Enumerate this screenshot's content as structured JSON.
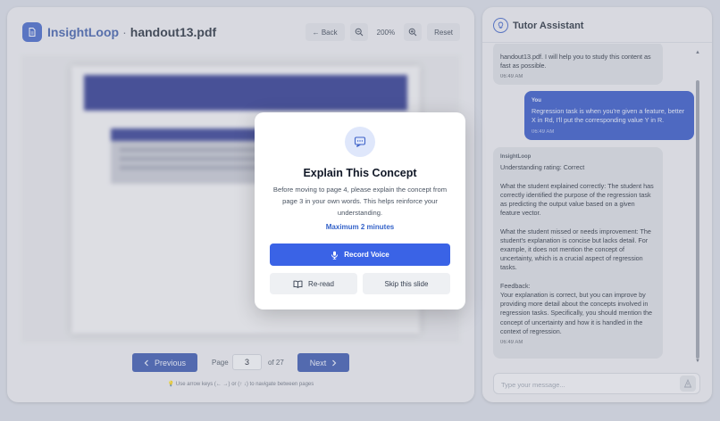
{
  "app": {
    "name": "InsightLoop",
    "separator": "·",
    "filename": "handout13.pdf"
  },
  "toolbar": {
    "back_label": "← Back",
    "zoom_level": "200%",
    "reset_label": "Reset"
  },
  "pager": {
    "previous_label": "Previous",
    "page_label": "Page",
    "current_page": "3",
    "of_label": "of 27",
    "next_label": "Next",
    "hint": "💡 Use arrow keys (← →) or (↑ ↓) to navigate between pages"
  },
  "chat": {
    "title": "Tutor Assistant",
    "messages": [
      {
        "sender": "",
        "text": "handout13.pdf. I will help you to study this content as fast as possible.",
        "time": "06:49 AM"
      },
      {
        "sender": "You",
        "text": "Regression task is when you're given a feature, better X in Rd, I'll put the corresponding value Y in R.",
        "time": "06:49 AM"
      },
      {
        "sender": "InsightLoop",
        "text": "Understanding rating: Correct\n\nWhat the student explained correctly: The student has correctly identified the purpose of the regression task as predicting the output value based on a given feature vector.\n\nWhat the student missed or needs improvement: The student's explanation is concise but lacks detail. For example, it does not mention the concept of uncertainty, which is a crucial aspect of regression tasks.\n\nFeedback:\nYour explanation is correct, but you can improve by providing more detail about the concepts involved in regression tasks. Specifically, you should mention the concept of uncertainty and how it is handled in the context of regression.",
        "time": "06:49 AM"
      }
    ],
    "input_placeholder": "Type your message..."
  },
  "modal": {
    "title": "Explain This Concept",
    "description": "Before moving to page 4, please explain the concept from page 3 in your own words. This helps reinforce your understanding.",
    "limit": "Maximum 2 minutes",
    "record_label": "Record Voice",
    "reread_label": "Re-read",
    "skip_label": "Skip this slide"
  },
  "colors": {
    "accent": "#3a63e6",
    "brand": "#3f63c8",
    "user_bubble": "#2f53c7"
  }
}
